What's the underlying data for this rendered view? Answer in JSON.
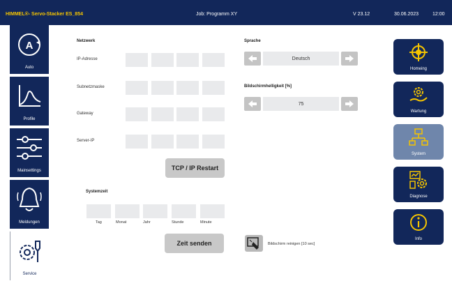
{
  "header": {
    "brand": "HIMMEL®- Servo-Stacker ES_854",
    "job": "Job: Programm XY",
    "version": "V 23.12",
    "date": "30.06.2023",
    "time": "12:00"
  },
  "left_nav": [
    {
      "label": "Auto",
      "icon": "auto-icon"
    },
    {
      "label": "Profile",
      "icon": "profile-curve-icon"
    },
    {
      "label": "Mainsettings",
      "icon": "sliders-icon"
    },
    {
      "label": "Meldungen",
      "icon": "bell-icon"
    },
    {
      "label": "Service",
      "icon": "tools-icon",
      "active": true
    }
  ],
  "network": {
    "title": "Netzwerk",
    "ip_label": "IP-Adresse",
    "subnet_label": "Subnetzmaske",
    "gateway_label": "Gateway",
    "server_label": "Server-IP",
    "restart_button": "TCP / IP Restart"
  },
  "language": {
    "title": "Sprache",
    "value": "Deutsch"
  },
  "brightness": {
    "title": "Bildschirmhelligkeit [%]",
    "value": "75"
  },
  "system_time": {
    "title": "Systemzeit",
    "labels": [
      "Tag",
      "Monat",
      "Jahr",
      "Stunde",
      "Minute"
    ],
    "send_button": "Zeit senden"
  },
  "clean_screen": {
    "label": "Bildschirm reinigen [10 sec]"
  },
  "right_nav": [
    {
      "label": "Homeing",
      "icon": "crosshair-icon"
    },
    {
      "label": "Wartung",
      "icon": "maintenance-gear-icon"
    },
    {
      "label": "System",
      "icon": "network-tree-icon",
      "active": true
    },
    {
      "label": "Diagnose",
      "icon": "diagnosis-icon"
    },
    {
      "label": "Info",
      "icon": "info-icon"
    }
  ],
  "colors": {
    "navy": "#12275a",
    "brand_yellow": "#f5c400",
    "active_tile": "#6f86ab"
  }
}
